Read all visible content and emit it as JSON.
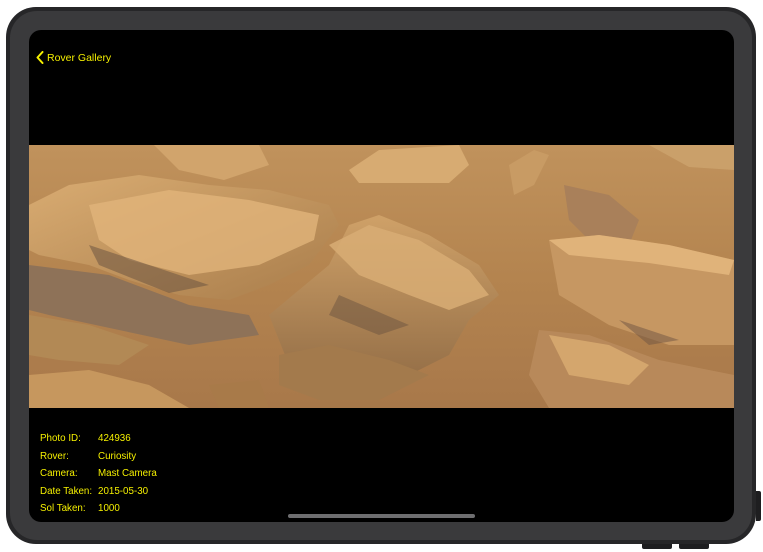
{
  "nav": {
    "back_label": "Rover Gallery"
  },
  "photo": {
    "description_icon": "mars-rock-photo"
  },
  "details": {
    "photo_id_label": "Photo ID:",
    "photo_id": "424936",
    "rover_label": "Rover:",
    "rover": "Curiosity",
    "camera_label": "Camera:",
    "camera": "Mast Camera",
    "date_label": "Date Taken:",
    "date": "2015-05-30",
    "sol_label": "Sol Taken:",
    "sol": "1000"
  },
  "colors": {
    "accent": "#f5f000",
    "background": "#000000"
  }
}
